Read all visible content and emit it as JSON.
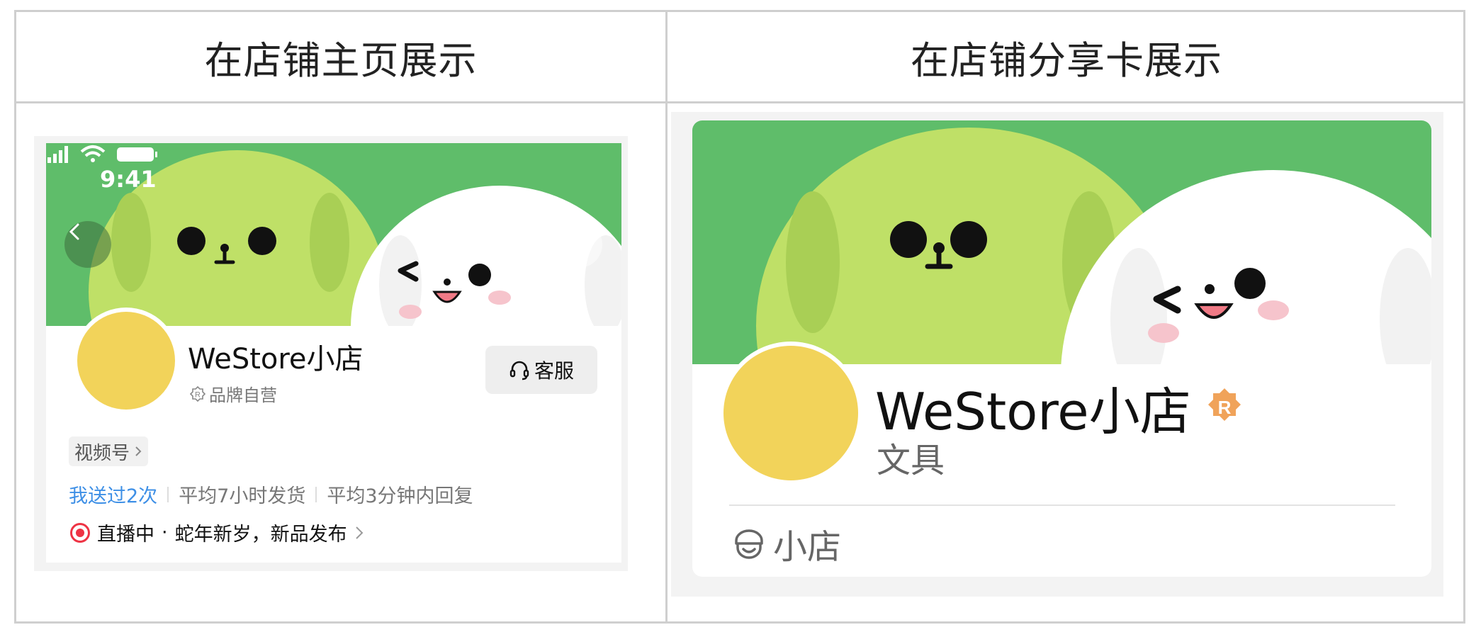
{
  "columns": {
    "left_title": "在店铺主页展示",
    "right_title": "在店铺分享卡展示"
  },
  "homepage": {
    "status_time": "9:41",
    "store_name": "WeStore小店",
    "brand_badge": "品牌自营",
    "service_label": "客服",
    "channel_label": "视频号",
    "stats": {
      "sent": "我送过2次",
      "ship": "平均7小时发货",
      "reply": "平均3分钟内回复"
    },
    "live": {
      "status": "直播中",
      "dot_sep": "·",
      "title": "蛇年新岁，新品发布"
    },
    "icons": [
      "back-icon",
      "search-icon",
      "cart-icon",
      "more-icon"
    ]
  },
  "share_card": {
    "store_name": "WeStore小店",
    "badge_letter": "R",
    "category": "文具",
    "store_type": "小店"
  },
  "colors": {
    "banner_green": "#5fbd6a",
    "avatar_yellow": "#f2d35a",
    "link_blue": "#3d8fe6",
    "live_red": "#ee3344",
    "badge_orange": "#f0a35a"
  }
}
